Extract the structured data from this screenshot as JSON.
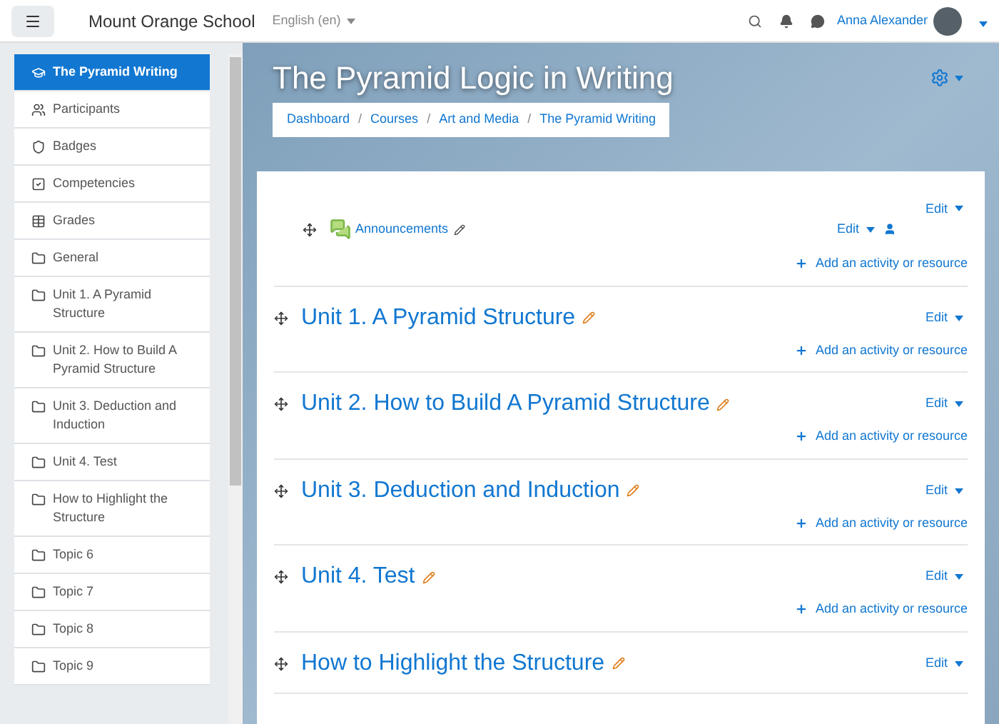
{
  "header": {
    "site_name": "Mount Orange School",
    "language": "English (en)",
    "user_name": "Anna Alexander"
  },
  "sidebar": {
    "items": [
      {
        "label": "The Pyramid Writing",
        "kind": "course",
        "selected": true
      },
      {
        "label": "Participants",
        "kind": "users",
        "selected": false
      },
      {
        "label": "Badges",
        "kind": "badge",
        "selected": false
      },
      {
        "label": "Competencies",
        "kind": "check",
        "selected": false
      },
      {
        "label": "Grades",
        "kind": "table",
        "selected": false
      },
      {
        "label": "General",
        "kind": "folder",
        "selected": false
      },
      {
        "label": "Unit 1. A Pyramid Structure",
        "kind": "folder",
        "selected": false
      },
      {
        "label": "Unit 2. How to Build A Pyramid Structure",
        "kind": "folder",
        "selected": false
      },
      {
        "label": "Unit 3. Deduction and Induction",
        "kind": "folder",
        "selected": false
      },
      {
        "label": "Unit 4. Test",
        "kind": "folder",
        "selected": false
      },
      {
        "label": "How to Highlight the Structure",
        "kind": "folder",
        "selected": false
      },
      {
        "label": "Topic 6",
        "kind": "folder",
        "selected": false
      },
      {
        "label": "Topic 7",
        "kind": "folder",
        "selected": false
      },
      {
        "label": "Topic 8",
        "kind": "folder",
        "selected": false
      },
      {
        "label": "Topic 9",
        "kind": "folder",
        "selected": false
      }
    ]
  },
  "course": {
    "title": "The Pyramid Logic in Writing",
    "breadcrumb": [
      "Dashboard",
      "Courses",
      "Art and Media",
      "The Pyramid Writing"
    ],
    "breadcrumb_separator": "/"
  },
  "sections": [
    {
      "edit": "Edit",
      "activities": [
        {
          "name": "Announcements",
          "edit": "Edit"
        }
      ],
      "add": "Add an activity or resource"
    },
    {
      "title": "Unit 1. A Pyramid Structure",
      "edit": "Edit",
      "add": "Add an activity or resource"
    },
    {
      "title": "Unit 2. How to Build A Pyramid Structure",
      "edit": "Edit",
      "add": "Add an activity or resource"
    },
    {
      "title": "Unit 3. Deduction and Induction",
      "edit": "Edit",
      "add": "Add an activity or resource"
    },
    {
      "title": "Unit 4. Test",
      "edit": "Edit",
      "add": "Add an activity or resource"
    },
    {
      "title": "How to Highlight the Structure",
      "edit": "Edit"
    }
  ]
}
